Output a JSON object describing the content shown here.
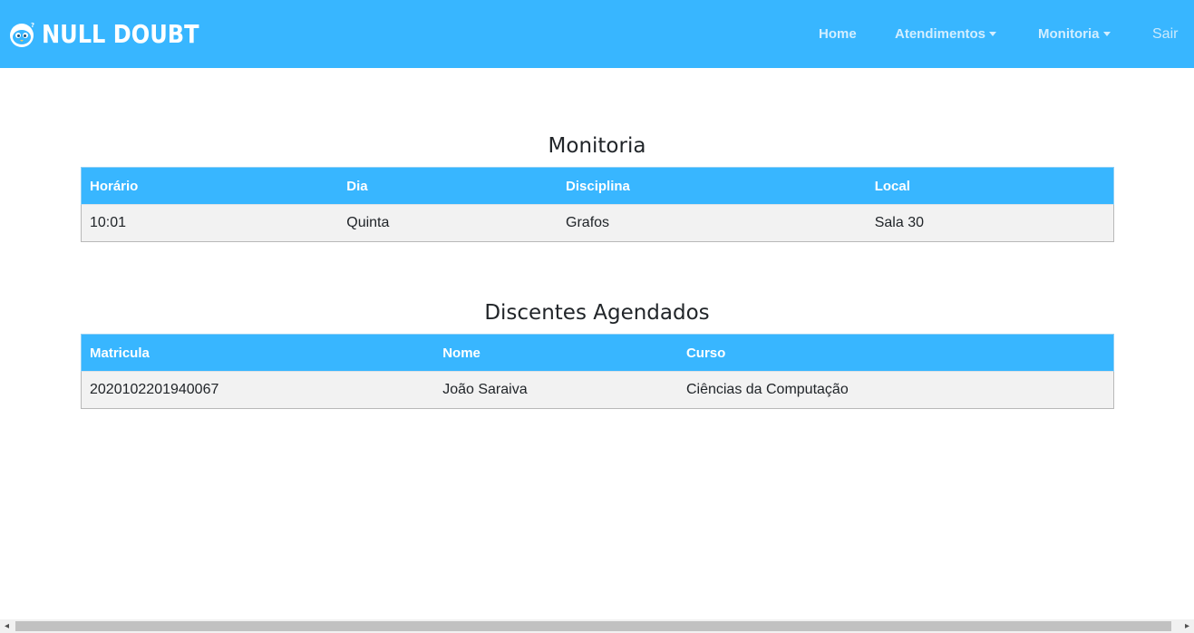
{
  "brand": {
    "name": "NULL DOUBT"
  },
  "nav": {
    "home": "Home",
    "atendimentos": "Atendimentos",
    "monitoria": "Monitoria",
    "sair": "Sair"
  },
  "monitoria_section": {
    "title": "Monitoria",
    "headers": [
      "Horário",
      "Dia",
      "Disciplina",
      "Local"
    ],
    "rows": [
      [
        "10:01",
        "Quinta",
        "Grafos",
        "Sala 30"
      ]
    ]
  },
  "discentes_section": {
    "title": "Discentes Agendados",
    "headers": [
      "Matricula",
      "Nome",
      "Curso"
    ],
    "rows": [
      [
        "2020102201940067",
        "João Saraiva",
        "Ciências da Computação"
      ]
    ]
  },
  "colors": {
    "navbar": "#38b6ff",
    "row_background": "#f2f2f2"
  }
}
